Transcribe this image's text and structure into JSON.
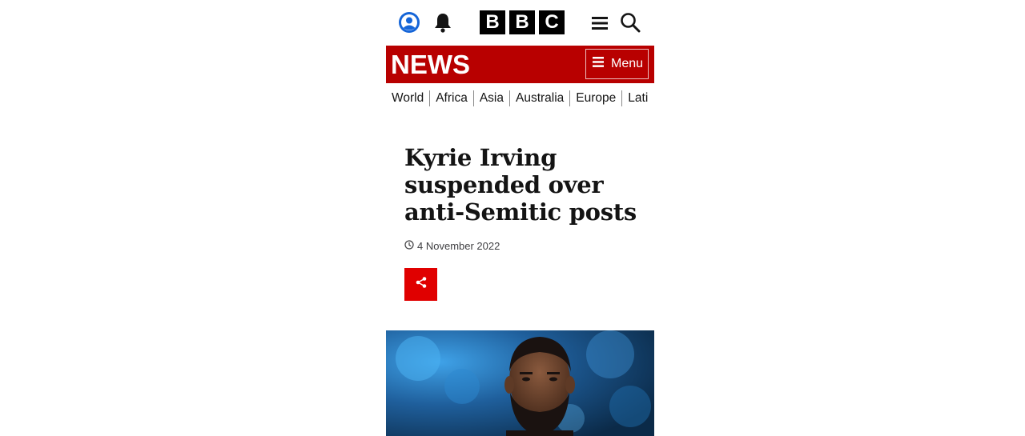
{
  "header": {
    "account_icon": "account-icon",
    "notifications_icon": "bell-icon",
    "logo_letters": [
      "B",
      "B",
      "C"
    ],
    "menu_icon": "hamburger-icon",
    "search_icon": "search-icon"
  },
  "newsbar": {
    "title": "NEWS",
    "menu_label": "Menu",
    "background": "#b80000"
  },
  "sections": [
    "World",
    "Africa",
    "Asia",
    "Australia",
    "Europe",
    "Lati"
  ],
  "article": {
    "headline": "Kyrie Irving suspended over anti-Semitic posts",
    "date": "4 November 2022",
    "share_icon": "share-icon",
    "share_color": "#e00000"
  }
}
